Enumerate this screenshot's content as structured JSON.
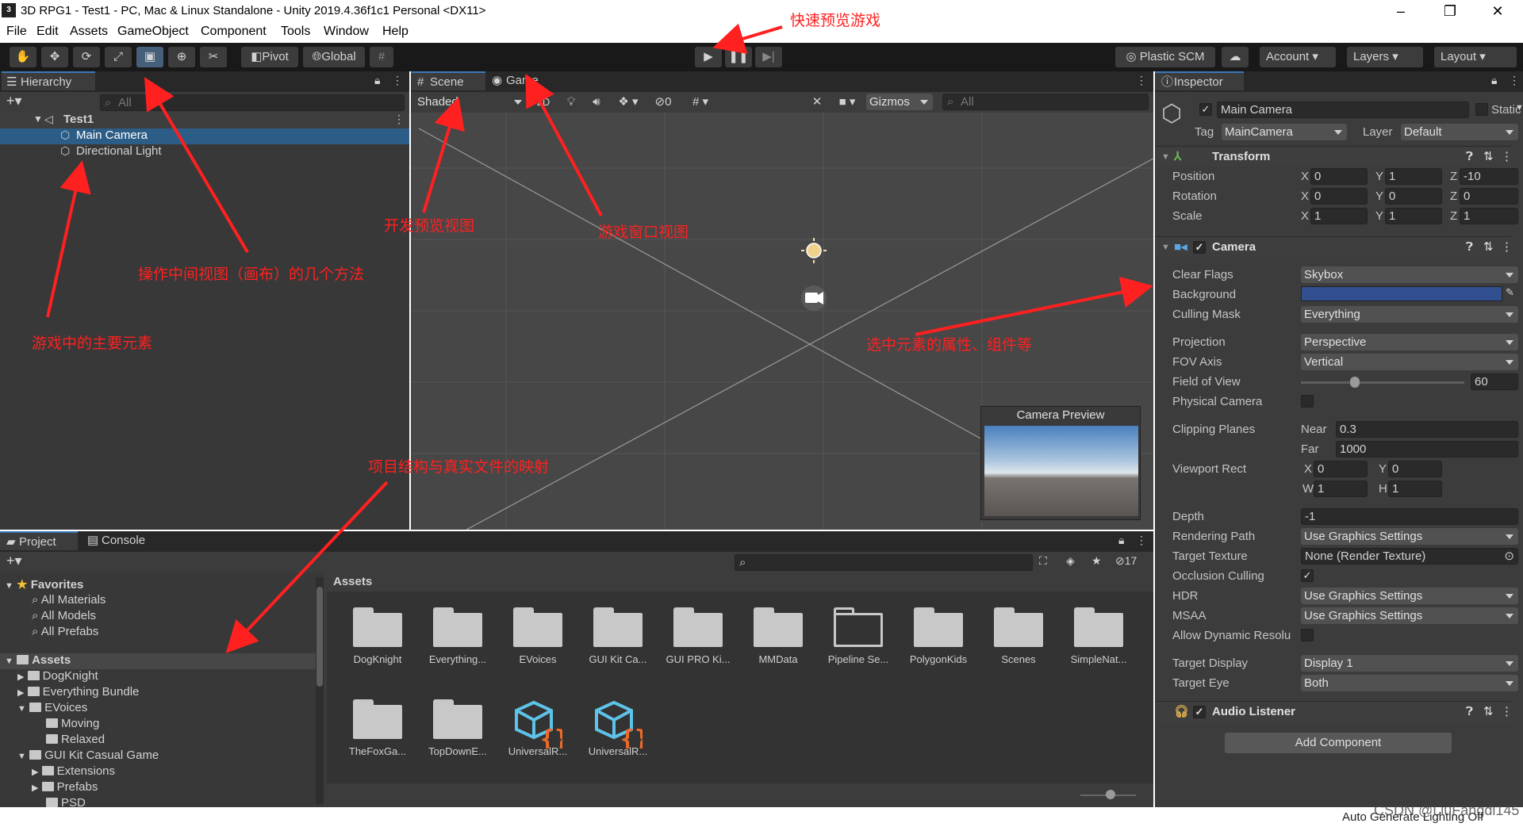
{
  "window": {
    "title": "3D RPG1 - Test1 - PC, Mac & Linux Standalone - Unity 2019.4.36f1c1 Personal <DX11>",
    "icon_text": "3"
  },
  "menu": [
    "File",
    "Edit",
    "Assets",
    "GameObject",
    "Component",
    "Tools",
    "Window",
    "Help"
  ],
  "toolbar": {
    "pivot": "Pivot",
    "global": "Global",
    "plastic": "Plastic SCM",
    "account": "Account",
    "layers": "Layers",
    "layout": "Layout"
  },
  "hierarchy": {
    "tab": "Hierarchy",
    "search_placeholder": "All",
    "scene": "Test1",
    "items": [
      "Main Camera",
      "Directional Light"
    ]
  },
  "scene": {
    "tab_scene": "Scene",
    "tab_game": "Game",
    "shading": "Shaded",
    "mode_2d": "2D",
    "hidden_count": "0",
    "gizmos": "Gizmos",
    "search_placeholder": "All",
    "camera_preview": "Camera Preview"
  },
  "project": {
    "tab_project": "Project",
    "tab_console": "Console",
    "hidden_count": "17",
    "favorites_label": "Favorites",
    "favorites": [
      "All Materials",
      "All Models",
      "All Prefabs"
    ],
    "assets_label": "Assets",
    "tree": [
      "DogKnight",
      "Everything Bundle",
      "EVoices",
      "Moving",
      "Relaxed",
      "GUI Kit Casual Game",
      "Extensions",
      "Prefabs",
      "PSD"
    ],
    "breadcrumb": "Assets",
    "grid": [
      "DogKnight",
      "Everything...",
      "EVoices",
      "GUI Kit Ca...",
      "GUI PRO Ki...",
      "MMData",
      "Pipeline Se...",
      "PolygonKids",
      "Scenes",
      "SimpleNat...",
      "TheFoxGa...",
      "TopDownE...",
      "UniversalR...",
      "UniversalR..."
    ]
  },
  "inspector": {
    "tab": "Inspector",
    "object_name": "Main Camera",
    "static_label": "Static",
    "tag_label": "Tag",
    "tag_value": "MainCamera",
    "layer_label": "Layer",
    "layer_value": "Default",
    "transform": {
      "title": "Transform",
      "rows": [
        {
          "label": "Position",
          "x": "0",
          "y": "1",
          "z": "-10"
        },
        {
          "label": "Rotation",
          "x": "0",
          "y": "0",
          "z": "0"
        },
        {
          "label": "Scale",
          "x": "1",
          "y": "1",
          "z": "1"
        }
      ]
    },
    "camera": {
      "title": "Camera",
      "clear_flags_label": "Clear Flags",
      "clear_flags": "Skybox",
      "background_label": "Background",
      "background_color": "#32508f",
      "culling_mask_label": "Culling Mask",
      "culling_mask": "Everything",
      "projection_label": "Projection",
      "projection": "Perspective",
      "fov_axis_label": "FOV Axis",
      "fov_axis": "Vertical",
      "fov_label": "Field of View",
      "fov": "60",
      "fov_slider": 0.33,
      "physical_label": "Physical Camera",
      "clipping_label": "Clipping Planes",
      "near_label": "Near",
      "near": "0.3",
      "far_label": "Far",
      "far": "1000",
      "viewport_label": "Viewport Rect",
      "vp_x": "0",
      "vp_y": "0",
      "vp_w": "1",
      "vp_h": "1",
      "depth_label": "Depth",
      "depth": "-1",
      "rendering_path_label": "Rendering Path",
      "rendering_path": "Use Graphics Settings",
      "target_texture_label": "Target Texture",
      "target_texture": "None (Render Texture)",
      "occlusion_label": "Occlusion Culling",
      "hdr_label": "HDR",
      "hdr": "Use Graphics Settings",
      "msaa_label": "MSAA",
      "msaa": "Use Graphics Settings",
      "dynres_label": "Allow Dynamic Resolu",
      "target_display_label": "Target Display",
      "target_display": "Display 1",
      "target_eye_label": "Target Eye",
      "target_eye": "Both"
    },
    "audio_listener": "Audio Listener",
    "add_component": "Add Component"
  },
  "status": {
    "text": "Auto Generate Lighting Off",
    "watermark": "CSDN @LiuFangdi145"
  },
  "annotations": {
    "play": "快速预览游戏",
    "tools": "操作中间视图（画布）的几个方法",
    "hierarchy": "游戏中的主要元素",
    "scene": "开发预览视图",
    "game": "游戏窗口视图",
    "inspector": "选中元素的属性、组件等",
    "project": "项目结构与真实文件的映射"
  },
  "colors": {
    "accent": "#3a79bb",
    "selection": "#2c5d87",
    "annotation": "#ff2020"
  }
}
